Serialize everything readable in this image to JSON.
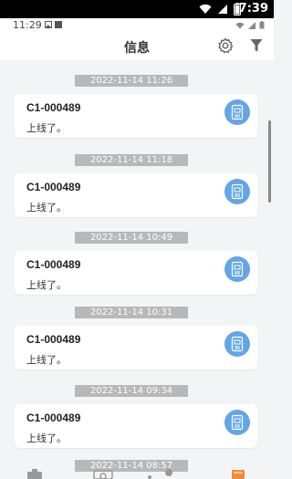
{
  "statusbar": {
    "time": "7:39"
  },
  "inner_statusbar": {
    "time": "11:29"
  },
  "header": {
    "title": "信息"
  },
  "messages": [
    {
      "timestamp": "2022-11-14 11:26",
      "device": "C1-000489",
      "text": "上线了。"
    },
    {
      "timestamp": "2022-11-14 11:18",
      "device": "C1-000489",
      "text": "上线了。"
    },
    {
      "timestamp": "2022-11-14 10:49",
      "device": "C1-000489",
      "text": "上线了。"
    },
    {
      "timestamp": "2022-11-14 10:31",
      "device": "C1-000489",
      "text": "上线了。"
    },
    {
      "timestamp": "2022-11-14 09:34",
      "device": "C1-000489",
      "text": "上线了。"
    },
    {
      "timestamp": "2022-11-14 08:57"
    }
  ],
  "colors": {
    "accent_blue": "#64a5e6",
    "timestamp_bg": "#b8b8b8",
    "tab_orange": "#f08a3c"
  },
  "icons": [
    "wifi-icon",
    "signal-icon",
    "battery-icon",
    "settings-icon",
    "filter-icon",
    "device-icon"
  ]
}
